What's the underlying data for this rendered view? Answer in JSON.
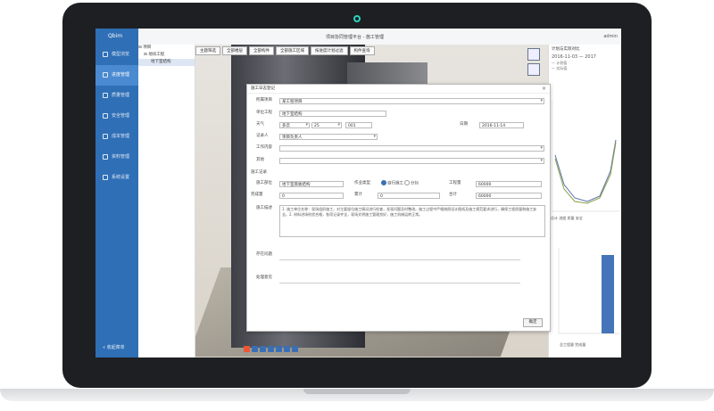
{
  "app": {
    "logo": "Qbim",
    "title": "项目协同管理平台 - 施工管理",
    "user": "admin"
  },
  "sidebar": {
    "items": [
      {
        "label": "模型浏览"
      },
      {
        "label": "进度管理"
      },
      {
        "label": "质量管理"
      },
      {
        "label": "安全管理"
      },
      {
        "label": "成本管理"
      },
      {
        "label": "资料管理"
      },
      {
        "label": "系统设置"
      }
    ],
    "collapse_label": "收起菜单"
  },
  "tree": {
    "root": "项目",
    "child": "地块工程",
    "selected": "地下室结构"
  },
  "view_toolbar": {
    "buttons": [
      "主题筛选",
      "全部楼层",
      "全部构件",
      "全部施工区域",
      "按进度计划过滤",
      "构件查询"
    ]
  },
  "right_panel": {
    "header": "计划与实际对比",
    "dates": [
      "2016-11-03",
      "2017"
    ],
    "legend": [
      "计划值",
      "实际值"
    ],
    "chart_tabs": [
      "总计",
      "进度",
      "质量",
      "安全"
    ],
    "chart2_legend": [
      "总工程量",
      "完成量"
    ],
    "colors": {
      "plan": "#5a6fa8",
      "actual": "#8aa04a",
      "bar": "#4674b8"
    }
  },
  "dialog": {
    "title": "施工日志登记",
    "close_icon": "close-icon",
    "fields": {
      "project_label": "所属项目",
      "project_value": "某工程项目",
      "unit_label": "单位工程",
      "unit_value": "地下室结构",
      "weather_label": "天气",
      "weather_value": "多云",
      "temp_value": "25",
      "temp2_value": "001",
      "date_label": "日期",
      "date_value": "2016-11-14",
      "person_label": "记录人",
      "person_value": "项目负责人",
      "work_label": "工作内容",
      "remark_label": "其他",
      "section_label": "施工记录",
      "part_label": "施工部位",
      "part_value": "地下室底板结构",
      "type_label": "作业类型",
      "radio_a": "自行施工",
      "radio_b": "分包",
      "amount_label": "工程量",
      "amount_value": "60000",
      "qty_label": "完成量",
      "qty_value": "0",
      "qty2_label": "累计",
      "qty2_value": "0",
      "qty3_label": "合计",
      "qty3_value": "60000",
      "desc_label": "施工描述",
      "desc_text": "1. 施工单位名称：现场组织施工，对主要部位施工情况进行检查，发现问题及时整改。施工过程中严格按照设计图纸及施工规范要求进行，确保工程质量和施工安全。2. 材料进场检验合格，各项记录齐全，现场文明施工管理良好，施工机械运转正常。",
      "problem_label": "存在问题",
      "handle_label": "处理意见",
      "confirm": "确定"
    }
  }
}
